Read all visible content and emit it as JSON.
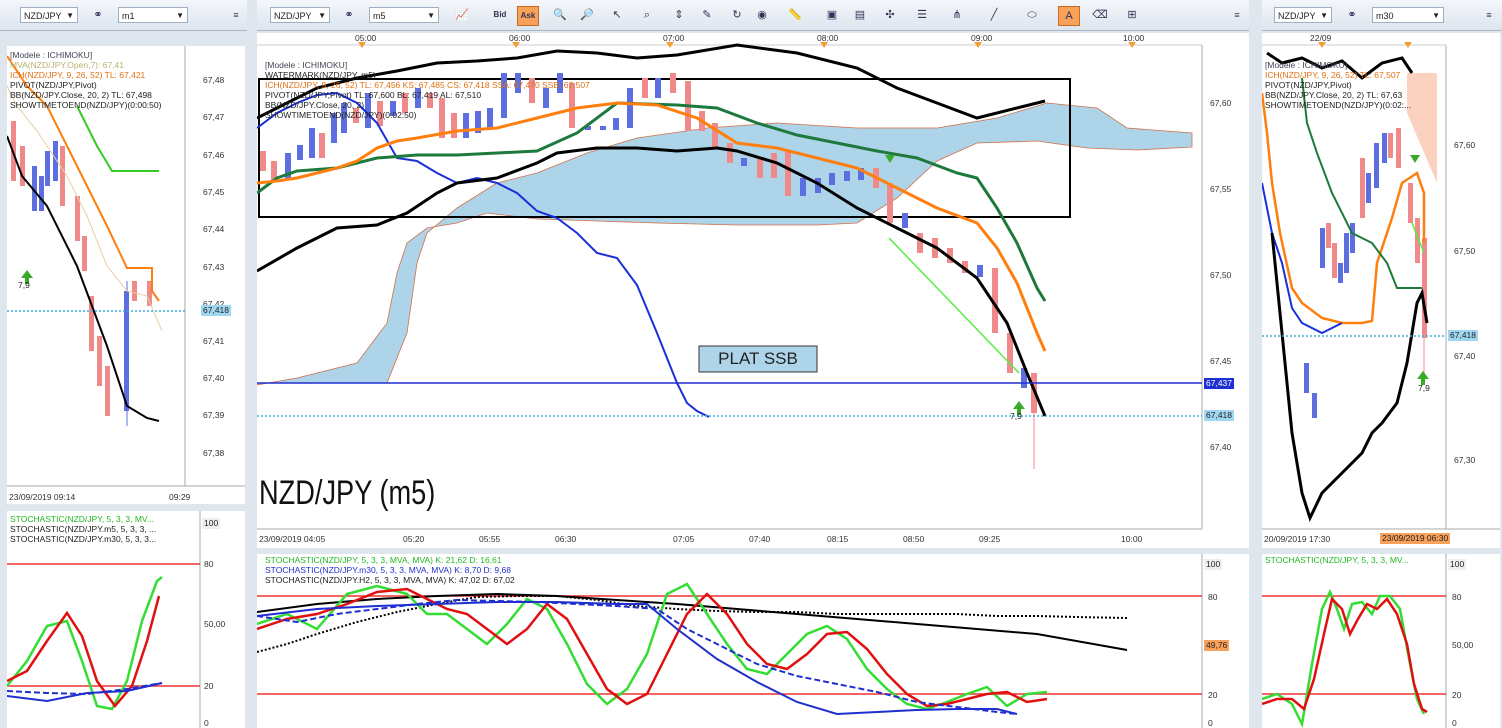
{
  "left": {
    "symbol": "NZD/JPY",
    "timeframe": "m1",
    "legend": [
      "[Modele : ICHIMOKU]",
      "MVA(NZD/JPY.Open,7): 67,41",
      "ICH(NZD/JPY, 9, 26, 52)  TL: 67,421",
      "PIVOT(NZD/JPY,Pivot)",
      "BB(NZD/JPY.Close, 20, 2)  TL: 67,498",
      "SHOWTIMETOEND(NZD/JPY)(0:00:50)"
    ],
    "yticks": [
      "67,48",
      "67,47",
      "67,46",
      "67,45",
      "67,44",
      "67,43",
      "67,42",
      "67,41",
      "67,40",
      "67,39",
      "67,38"
    ],
    "price_tag": "67,418",
    "arrow_label": "7,9",
    "xlabels": [
      "23/09/2019 09:14",
      "09:29"
    ],
    "stoch_legend": [
      "STOCHASTIC(NZD/JPY, 5, 3, 3, MV...",
      "STOCHASTIC(NZD/JPY.m5, 5, 3, 3, ...",
      "STOCHASTIC(NZD/JPY.m30, 5, 3, 3..."
    ],
    "stoch_ticks": [
      "100",
      "80",
      "50,00",
      "20",
      "0"
    ]
  },
  "main": {
    "symbol": "NZD/JPY",
    "timeframe": "m5",
    "bid_label": "Bid",
    "ask_label": "Ask",
    "top_times": [
      "05:00",
      "06:00",
      "07:00",
      "08:00",
      "09:00",
      "10:00"
    ],
    "legend": [
      "[Modele : ICHIMOKU]",
      "WATERMARK(NZD/JPY, m5)",
      "ICH(NZD/JPY, 9, 26, 52)  TL: 67,456  KS: 67,485  CS: 67,418  SSA: 67,470  SSB: 67,507",
      "PIVOT(NZD/JPY,Pivot)  TL: 67,600  BL: 67,419  AL: 67,510",
      "BB(NZD/JPY.Close, 20, 2)",
      "SHOWTIMETOEND(NZD/JPY)(0:02:50)"
    ],
    "annotation": "PLAT SSB",
    "watermark": "NZD/JPY (m5)",
    "yticks": [
      "67,60",
      "67,55",
      "67,50",
      "67,45",
      "67,40"
    ],
    "price_tag_blue": "67,437",
    "price_tag_cyan": "67,418",
    "arrow_label": "7,9",
    "xlabels": [
      "23/09/2019 04:05",
      "05:20",
      "05:55",
      "06:30",
      "07:05",
      "07:40",
      "08:15",
      "08:50",
      "09:25",
      "10:00"
    ],
    "stoch_legend": [
      "STOCHASTIC(NZD/JPY, 5, 3, 3, MVA, MVA)  K: 21,62  D: 16,61",
      "STOCHASTIC(NZD/JPY.m30, 5, 3, 3, MVA, MVA)  K: 8,70  D: 9,68",
      "STOCHASTIC(NZD/JPY.H2, 5, 3, 3, MVA, MVA)  K: 47,02  D: 67,02"
    ],
    "stoch_ticks": [
      "100",
      "80",
      "49,76",
      "20",
      "0"
    ]
  },
  "right": {
    "symbol": "NZD/JPY",
    "timeframe": "m30",
    "top_date": "22/09",
    "legend": [
      "[Modele : ICHIMOKU]",
      "ICH(NZD/JPY, 9, 26, 52)  TL: 67,507",
      "PIVOT(NZD/JPY,Pivot)",
      "BB(NZD/JPY.Close, 20, 2)  TL: 67,63",
      "SHOWTIMETOEND(NZD/JPY)(0:02:..."
    ],
    "yticks": [
      "67,60",
      "67,50",
      "67,40",
      "67,30"
    ],
    "price_tag": "67,418",
    "arrow_label": "7,9",
    "xlabels": [
      "20/09/2019 17:30",
      "23/09/2019 06:30"
    ],
    "stoch_legend": [
      "STOCHASTIC(NZD/JPY, 5, 3, 3, MV..."
    ],
    "stoch_ticks": [
      "100",
      "80",
      "50,00",
      "20",
      "0"
    ]
  },
  "colors": {
    "up": "#5d6fe0",
    "down": "#f08a8a",
    "ssb_cloud": "#aed4ea",
    "ks": "#1e7a3c",
    "tl": "#ff7f0e",
    "bb": "#000000",
    "cs": "#1a2fd8",
    "stoch_k": "#33dd33",
    "stoch_d": "#e01010",
    "stoch_m30": "#1f2fd0"
  }
}
